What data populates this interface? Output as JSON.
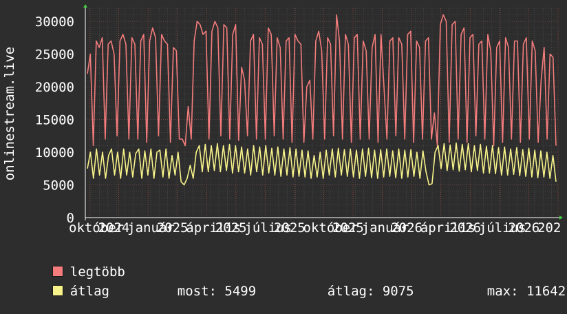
{
  "chart_data": {
    "type": "line",
    "ylabel": "onlinestream.live",
    "ylim": [
      0,
      32000
    ],
    "yticks": [
      0,
      5000,
      10000,
      15000,
      20000,
      25000,
      30000
    ],
    "xticks": [
      "október",
      "2024",
      "január",
      "2025",
      "április",
      "2025",
      "július",
      "2025",
      "október",
      "2025",
      "január",
      "2026",
      "április",
      "2026",
      "július",
      "2026",
      "202"
    ],
    "grid": true,
    "colors": {
      "background": "#2d2d2d",
      "plot": "#2d2d2d",
      "grid": "#555555",
      "axis": "#ffffff",
      "legtobb": "#f47c7c",
      "atlag": "#f7f38a"
    },
    "series": [
      {
        "name": "legtöbb",
        "color": "#f47c7c",
        "points_per_segment": 8,
        "values": [
          22000,
          25000,
          11000,
          27000,
          26000,
          27500,
          12000,
          26500,
          27000,
          25000,
          12500,
          27000,
          28000,
          26500,
          12000,
          27500,
          26500,
          12000,
          27000,
          28000,
          11500,
          27000,
          29000,
          27500,
          12500,
          28000,
          27000,
          26500,
          11500,
          26000,
          25500,
          12000,
          12000,
          11000,
          17000,
          12000,
          27000,
          30000,
          29500,
          28000,
          28500,
          12000,
          28500,
          30000,
          29000,
          12500,
          29500,
          29000,
          12000,
          28000,
          29500,
          11800,
          23000,
          21000,
          12500,
          27000,
          28000,
          12000,
          27500,
          26500,
          12000,
          29000,
          28000,
          12500,
          27500,
          26000,
          12000,
          27000,
          27500,
          11500,
          28000,
          27000,
          26500,
          11500,
          20000,
          21000,
          12000,
          27000,
          28500,
          25500,
          12000,
          27500,
          26500,
          12500,
          31000,
          27000,
          12000,
          28000,
          26500,
          11500,
          27500,
          28000,
          12000,
          27000,
          25500,
          12000,
          26000,
          28000,
          11500,
          28000,
          20000,
          12000,
          27000,
          27500,
          12500,
          27500,
          26500,
          12000,
          28000,
          28500,
          11500,
          27000,
          26000,
          12000,
          27000,
          27500,
          12000,
          16000,
          11000,
          29500,
          31000,
          30000,
          11500,
          29500,
          30000,
          12000,
          28000,
          29000,
          11500,
          27500,
          28000,
          12500,
          26500,
          27000,
          12000,
          28000,
          25500,
          11000,
          26000,
          27000,
          11500,
          27500,
          26000,
          12000,
          27000,
          27000,
          11500,
          26500,
          27500,
          12000,
          27000,
          25500,
          11500,
          21000,
          26000,
          12000,
          25000,
          24500,
          11000
        ]
      },
      {
        "name": "átlag",
        "color": "#f7f38a",
        "points_per_segment": 8,
        "values": [
          7500,
          10000,
          6000,
          10500,
          6500,
          10000,
          6000,
          9500,
          10500,
          6500,
          10000,
          6000,
          10500,
          6500,
          10000,
          6200,
          9800,
          10500,
          6000,
          10200,
          6500,
          10500,
          6000,
          10000,
          10300,
          6200,
          10500,
          6000,
          9500,
          6500,
          10000,
          5500,
          5000,
          6000,
          8000,
          6000,
          10000,
          11000,
          7000,
          11200,
          7000,
          11000,
          7200,
          11300,
          7000,
          11000,
          7200,
          11200,
          6800,
          11000,
          7000,
          10800,
          6800,
          10500,
          6500,
          11000,
          7000,
          10800,
          6500,
          11000,
          6800,
          10600,
          6500,
          10800,
          6300,
          10500,
          6500,
          10700,
          6200,
          10500,
          6300,
          10300,
          6200,
          10200,
          6000,
          9500,
          6200,
          10000,
          6000,
          10300,
          6500,
          10500,
          6200,
          10600,
          6500,
          10400,
          6300,
          10500,
          6200,
          10300,
          6000,
          10500,
          6300,
          10600,
          6100,
          10300,
          6000,
          10400,
          6200,
          10500,
          6300,
          10200,
          6100,
          10500,
          6000,
          10300,
          6200,
          10400,
          6300,
          10000,
          6000,
          10200,
          7000,
          5000,
          5200,
          10000,
          11000,
          7500,
          11300,
          7200,
          11100,
          7300,
          11400,
          7100,
          11200,
          7300,
          11300,
          7000,
          11000,
          7200,
          11200,
          6800,
          10900,
          6800,
          11000,
          6700,
          10700,
          6500,
          10800,
          6500,
          10500,
          6600,
          10700,
          6400,
          10400,
          6300,
          10600,
          6200,
          10300,
          6100,
          10200,
          6200,
          10000,
          6000,
          9500,
          5499
        ]
      }
    ],
    "legend": [
      {
        "label": "legtöbb",
        "color": "#f47c7c"
      },
      {
        "label": "átlag",
        "color": "#f7f38a"
      }
    ],
    "stats": {
      "most_label": "most:",
      "most_value": "5499",
      "atlag_label": "átlag:",
      "atlag_value": "9075",
      "max_label": "max:",
      "max_value": "11642"
    }
  }
}
